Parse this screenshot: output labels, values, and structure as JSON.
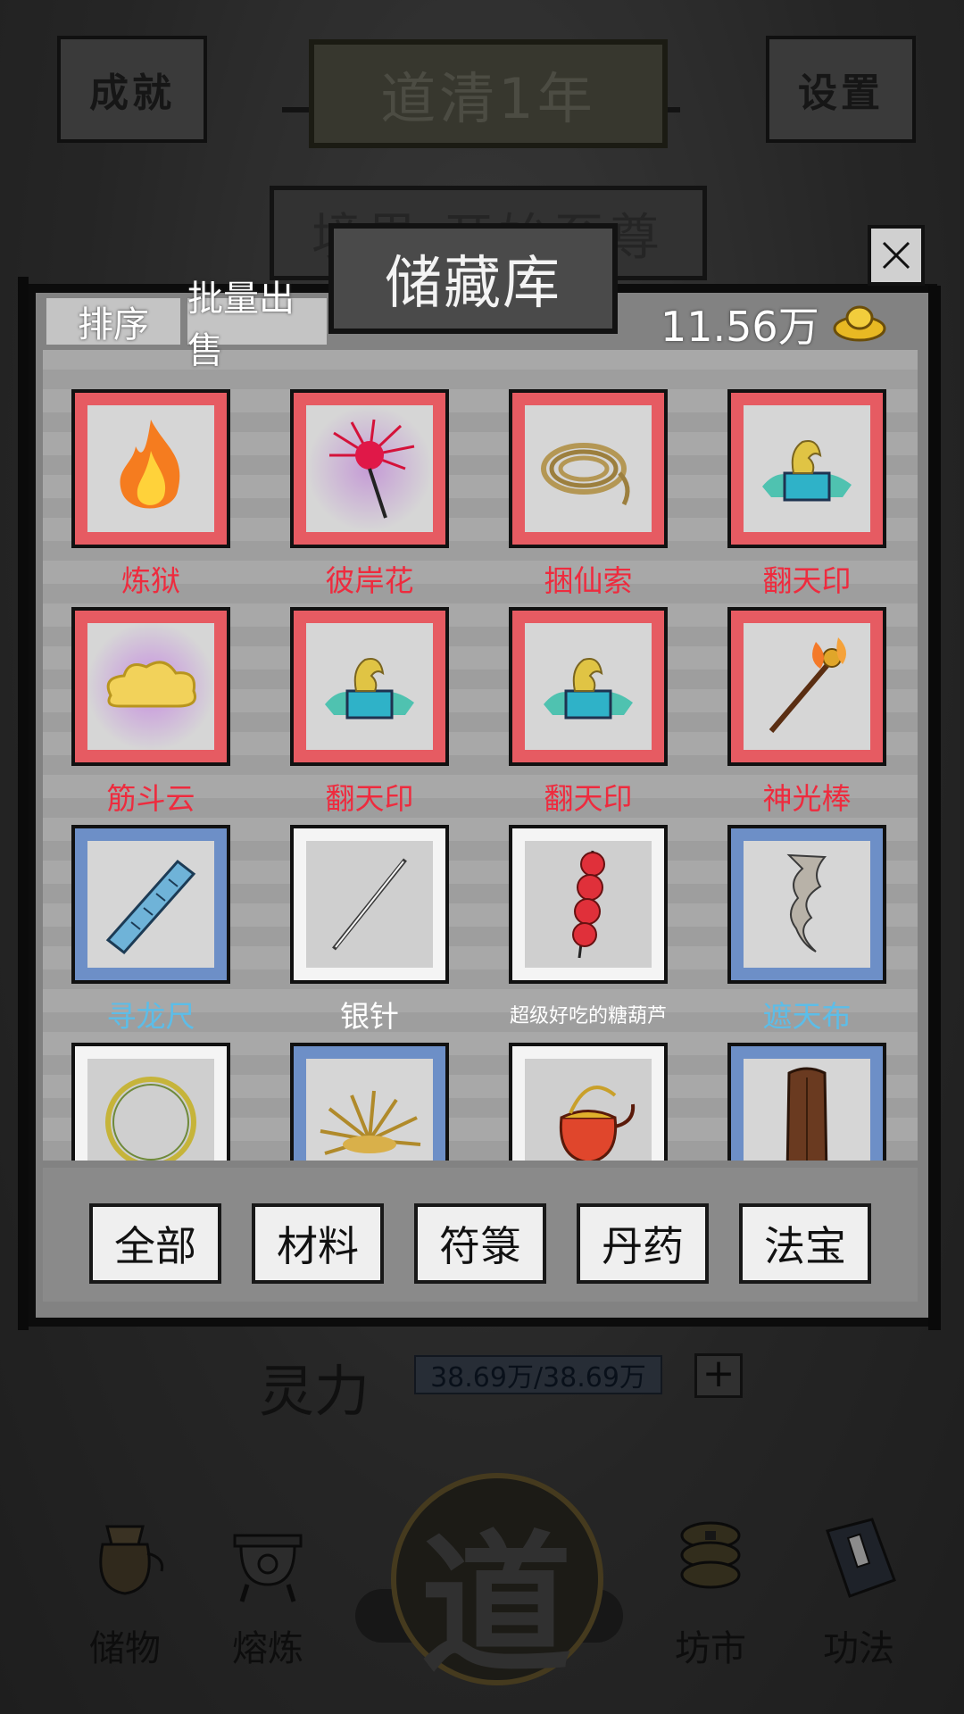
{
  "header": {
    "achievements_label": "成就",
    "year_label": "道清1年",
    "settings_label": "设置",
    "realm_label": "境界 开始至尊"
  },
  "status": {
    "lingli_label": "灵力",
    "lingli_value": "38.69万/38.69万",
    "plus_label": "+"
  },
  "bottom_nav": {
    "items": [
      {
        "label": "储物",
        "icon": "pouch-icon"
      },
      {
        "label": "熔炼",
        "icon": "cauldron-icon"
      },
      {
        "label": "道",
        "icon": "dao-emblem"
      },
      {
        "label": "坊市",
        "icon": "coins-icon"
      },
      {
        "label": "功法",
        "icon": "book-icon"
      }
    ]
  },
  "modal": {
    "title": "储藏库",
    "close_icon": "close-icon",
    "sort_label": "排序",
    "bulk_sell_label": "批量出售",
    "money": "11.56万",
    "money_icon": "gold-ingot-icon",
    "items": [
      {
        "name": "炼狱",
        "rarity": "red",
        "icon": "flame-icon"
      },
      {
        "name": "彼岸花",
        "rarity": "red",
        "icon": "spider-lily-icon"
      },
      {
        "name": "捆仙索",
        "rarity": "red",
        "icon": "rope-icon"
      },
      {
        "name": "翻天印",
        "rarity": "red",
        "icon": "dragon-seal-icon"
      },
      {
        "name": "筋斗云",
        "rarity": "red",
        "icon": "cloud-icon"
      },
      {
        "name": "翻天印",
        "rarity": "red",
        "icon": "dragon-seal-icon"
      },
      {
        "name": "翻天印",
        "rarity": "red",
        "icon": "dragon-seal-icon"
      },
      {
        "name": "神光棒",
        "rarity": "red",
        "icon": "staff-icon"
      },
      {
        "name": "寻龙尺",
        "rarity": "blue",
        "icon": "ruler-icon"
      },
      {
        "name": "银针",
        "rarity": "white",
        "icon": "needle-icon"
      },
      {
        "name": "超级好吃的糖葫芦",
        "rarity": "white",
        "icon": "candied-haws-icon"
      },
      {
        "name": "遮天布",
        "rarity": "blue",
        "icon": "cloth-icon"
      },
      {
        "name": "",
        "rarity": "white",
        "icon": "ring-icon"
      },
      {
        "name": "",
        "rarity": "blue",
        "icon": "burst-icon"
      },
      {
        "name": "",
        "rarity": "white",
        "icon": "teapot-icon"
      },
      {
        "name": "",
        "rarity": "blue",
        "icon": "tablet-icon"
      }
    ],
    "tabs": [
      {
        "label": "全部"
      },
      {
        "label": "材料"
      },
      {
        "label": "符箓"
      },
      {
        "label": "丹药"
      },
      {
        "label": "法宝"
      }
    ]
  },
  "colors": {
    "rarity_red": "#ee2b3e",
    "rarity_blue": "#5cbde8",
    "rarity_white": "#ffffff",
    "frame_red": "#e65b62",
    "frame_blue": "#6d8fc7"
  }
}
